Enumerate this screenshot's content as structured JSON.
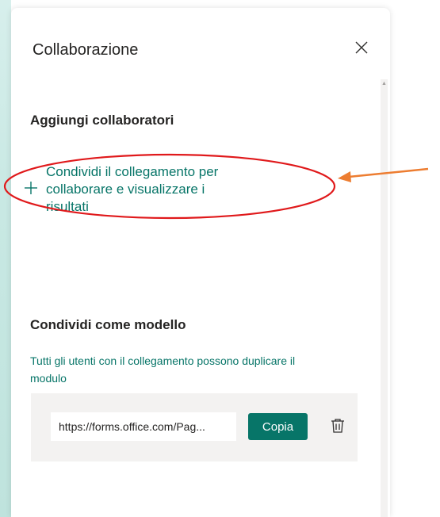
{
  "panel": {
    "title": "Collaborazione",
    "close_icon": "close-icon"
  },
  "add_collaborators": {
    "heading": "Aggiungi collaboratori",
    "share_link_lines": [
      "Condividi il collegamento per",
      "collaborare e visualizzare i",
      "risultati"
    ],
    "icon": "plus-icon"
  },
  "share_template": {
    "heading": "Condividi come modello",
    "description_lines": [
      "Tutti gli utenti con il collegamento possono duplicare il",
      "modulo"
    ],
    "link_value": "https://forms.office.com/Pag...",
    "copy_label": "Copia",
    "delete_icon": "trash-icon"
  },
  "colors": {
    "accent": "#077568",
    "annotation_ellipse": "#e0191b",
    "annotation_arrow": "#ed7d31",
    "background_strip": "#c8e8e3"
  }
}
